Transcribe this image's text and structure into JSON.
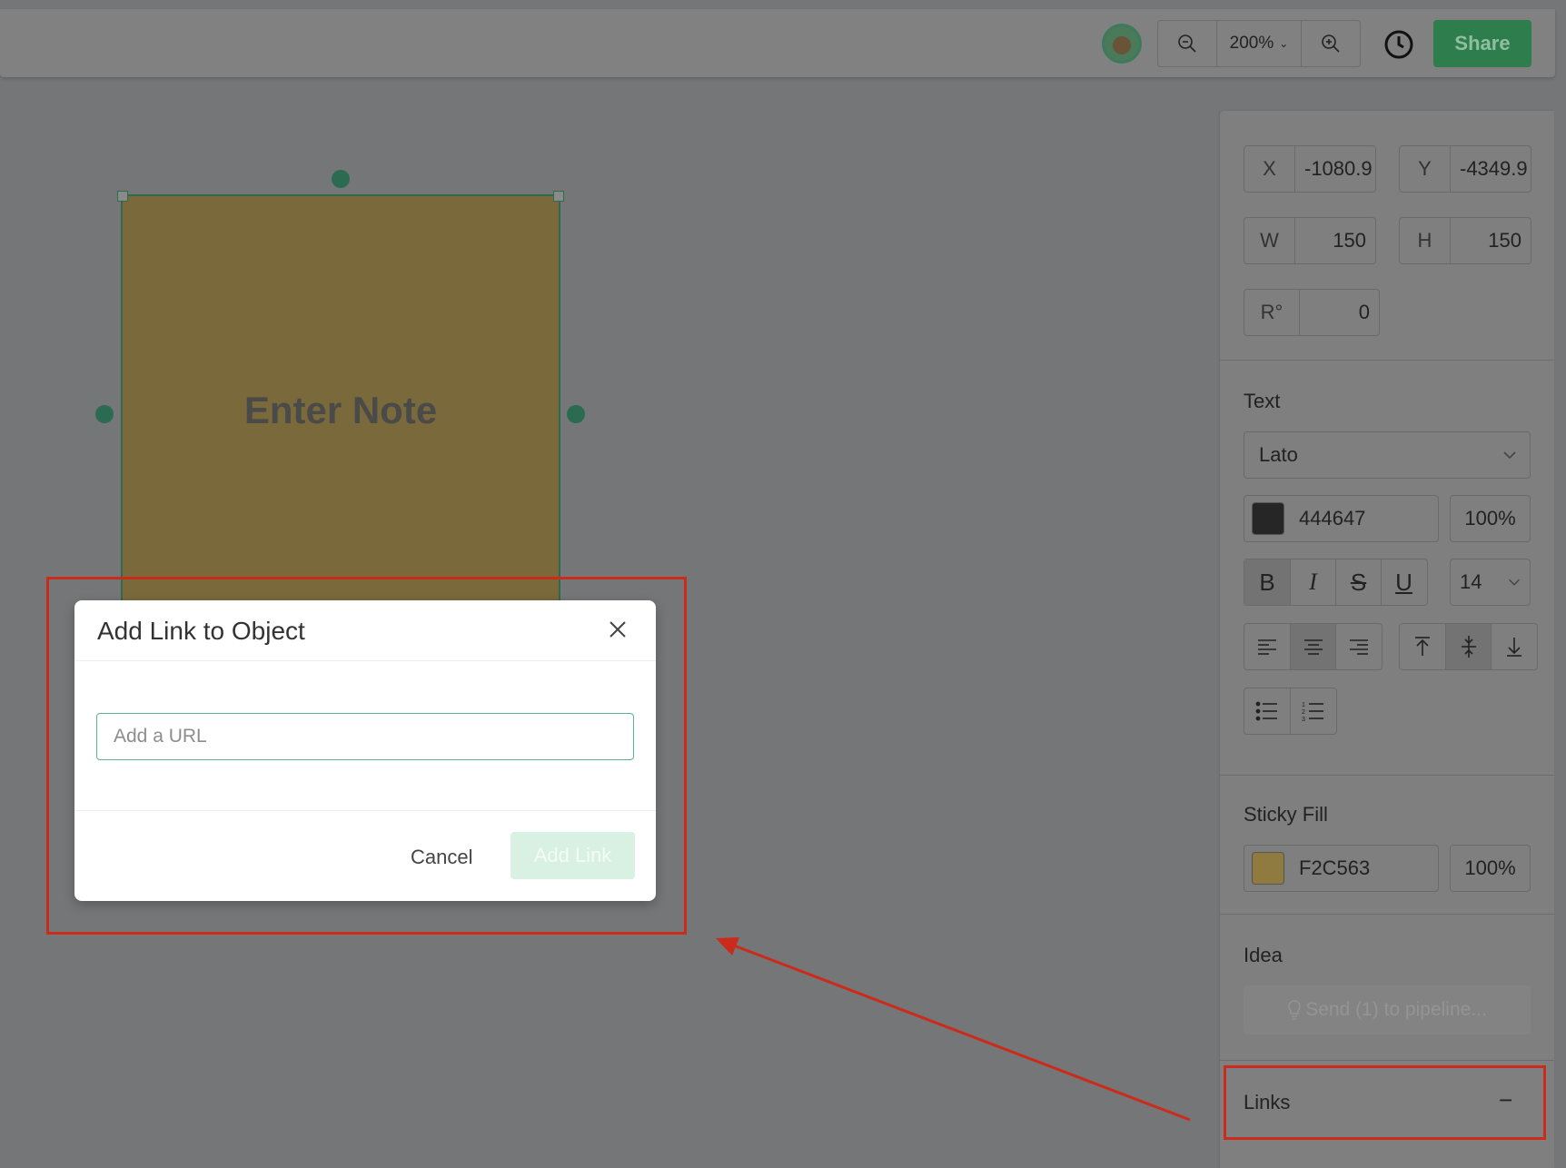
{
  "toolbar": {
    "zoom_out_icon": "zoom-out-icon",
    "zoom_level": "200%",
    "zoom_in_icon": "zoom-in-icon",
    "history_icon": "clock-icon",
    "share_label": "Share"
  },
  "canvas": {
    "note_text": "Enter Note",
    "note_fill": "#7a693b"
  },
  "panel": {
    "x_label": "X",
    "x_value": "-1080.9",
    "y_label": "Y",
    "y_value": "-4349.9",
    "w_label": "W",
    "w_value": "150",
    "h_label": "H",
    "h_value": "150",
    "r_label": "R°",
    "r_value": "0",
    "text_title": "Text",
    "font": "Lato",
    "text_color": "444647",
    "text_opacity": "100%",
    "bold": "B",
    "italic": "I",
    "strike": "S",
    "underline": "U",
    "font_size": "14",
    "sticky_fill_title": "Sticky Fill",
    "fill_color": "F2C563",
    "fill_opacity": "100%",
    "idea_title": "Idea",
    "send_pipeline": "Send (1) to pipeline...",
    "links_title": "Links",
    "links_toggle": "−"
  },
  "dialog": {
    "title": "Add Link to Object",
    "url_placeholder": "Add a URL",
    "cancel_label": "Cancel",
    "add_link_label": "Add Link"
  },
  "colors": {
    "accent": "#2e7d4c",
    "annotation": "#cc2a1a"
  }
}
